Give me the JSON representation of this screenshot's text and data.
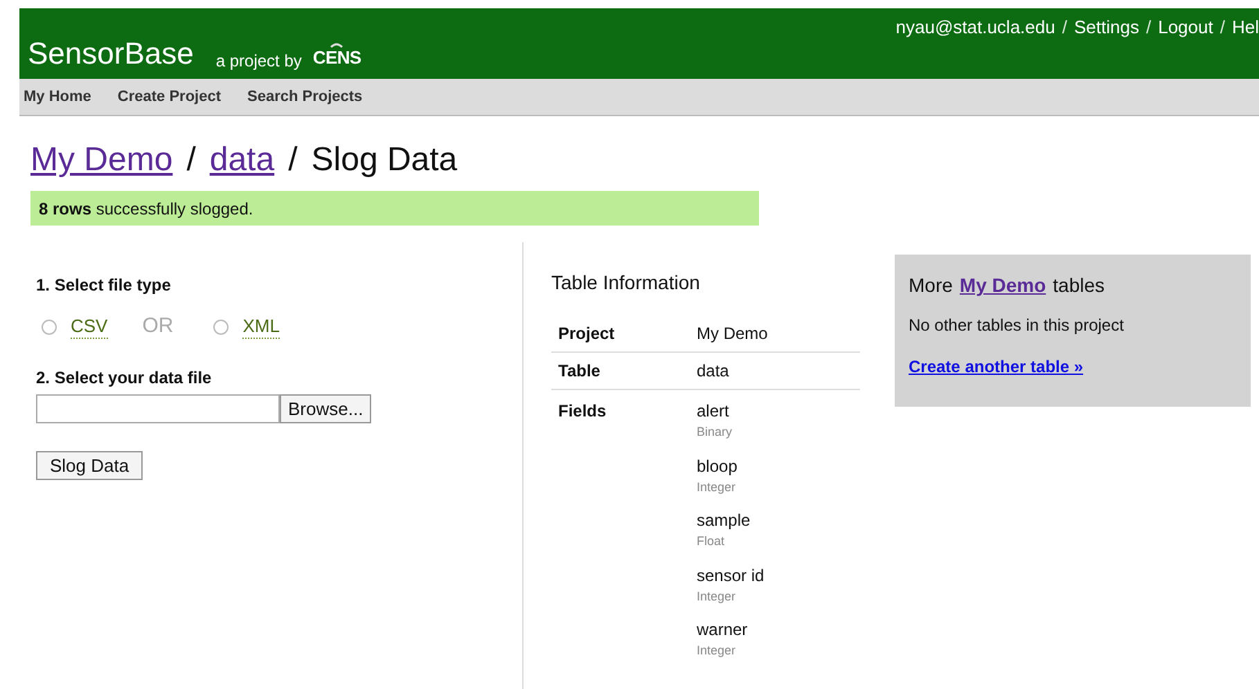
{
  "header": {
    "brand": "SensorBase",
    "tagline": "a project by",
    "logo": "CENS",
    "user_links": [
      {
        "kind": "link",
        "text": "nyau@stat.ucla.edu"
      },
      {
        "kind": "separator",
        "text": "/"
      },
      {
        "kind": "link",
        "text": "Settings"
      },
      {
        "kind": "separator",
        "text": "/"
      },
      {
        "kind": "link",
        "text": "Logout"
      },
      {
        "kind": "separator",
        "text": "/"
      },
      {
        "kind": "link",
        "text": "Hel"
      }
    ]
  },
  "nav": [
    "My Home",
    "Create Project",
    "Search Projects"
  ],
  "breadcrumb": [
    {
      "kind": "link",
      "text": "My Demo"
    },
    {
      "kind": "separator",
      "text": "/"
    },
    {
      "kind": "link",
      "text": "data"
    },
    {
      "kind": "separator",
      "text": "/"
    },
    {
      "kind": "current",
      "text": "Slog Data"
    }
  ],
  "notice": "**8 rows** successfully slogged.",
  "form": {
    "step1": "1. Select file type",
    "file_types": [
      {
        "label": "CSV",
        "selected": false
      },
      {
        "label": "XML",
        "selected": false
      }
    ],
    "or_text": "OR",
    "step2": "2. Select your data file",
    "browse": "Browse...",
    "submit": "Slog Data"
  },
  "table_info": {
    "title": "Table Information",
    "rows": [
      {
        "label": "Project",
        "value": "My Demo"
      },
      {
        "label": "Table",
        "value": "data"
      }
    ],
    "fields_label": "Fields",
    "fields": [
      {
        "name": "alert",
        "type": "Binary"
      },
      {
        "name": "bloop",
        "type": "Integer"
      },
      {
        "name": "sample",
        "type": "Float"
      },
      {
        "name": "sensor id",
        "type": "Integer"
      },
      {
        "name": "warner",
        "type": "Integer"
      }
    ]
  },
  "more_box": {
    "title_pre": "More",
    "title_link": "My Demo",
    "title_post": "tables",
    "message": "No other tables in this project",
    "create_link": "Create another table »"
  }
}
